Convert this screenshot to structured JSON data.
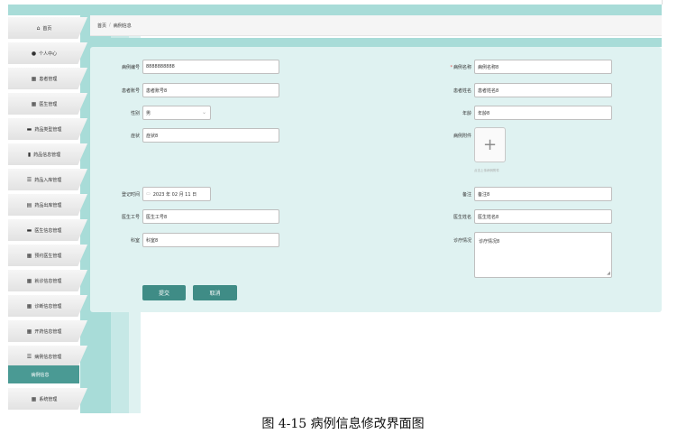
{
  "sidebar": {
    "items": [
      {
        "label": "首页",
        "icon": "home-icon",
        "glyph": "⌂"
      },
      {
        "label": "个人中心",
        "icon": "user-icon",
        "glyph": "●"
      },
      {
        "label": "患者管理",
        "icon": "grid-icon",
        "glyph": "▦"
      },
      {
        "label": "医生管理",
        "icon": "grid-icon",
        "glyph": "▦"
      },
      {
        "label": "药品类型管理",
        "icon": "briefcase-icon",
        "glyph": "▬"
      },
      {
        "label": "药品信息管理",
        "icon": "trash-icon",
        "glyph": "▮"
      },
      {
        "label": "药品入库管理",
        "icon": "list-icon",
        "glyph": "☰"
      },
      {
        "label": "药品出库管理",
        "icon": "document-icon",
        "glyph": "▤"
      },
      {
        "label": "医生信息管理",
        "icon": "message-icon",
        "glyph": "▬"
      },
      {
        "label": "预约医生管理",
        "icon": "grid-icon",
        "glyph": "▦"
      },
      {
        "label": "就诊信息管理",
        "icon": "grid-icon",
        "glyph": "▦"
      },
      {
        "label": "诊断信息管理",
        "icon": "grid-icon",
        "glyph": "▦"
      },
      {
        "label": "开药信息管理",
        "icon": "grid-icon",
        "glyph": "▦"
      },
      {
        "label": "病例信息管理",
        "icon": "menu-icon",
        "glyph": "☰"
      },
      {
        "label": "病例信息",
        "icon": "",
        "glyph": ""
      },
      {
        "label": "系统管理",
        "icon": "grid-icon",
        "glyph": "▦"
      }
    ],
    "active_index": 14
  },
  "breadcrumb": {
    "home": "首页",
    "separator": "/",
    "current": "病例信息"
  },
  "form": {
    "case_no": {
      "label": "病例编号",
      "value": "8888888888"
    },
    "case_name": {
      "label": "病例名称",
      "required_mark": "*",
      "value": "病例名称8"
    },
    "patient_account": {
      "label": "患者账号",
      "value": "患者账号8"
    },
    "patient_name": {
      "label": "患者姓名",
      "value": "患者姓名8"
    },
    "gender": {
      "label": "性别",
      "value": "男"
    },
    "age": {
      "label": "年龄",
      "value": "年龄8"
    },
    "symptom": {
      "label": "症状",
      "value": "症状8"
    },
    "attachment": {
      "label": "病例附件",
      "plus": "+",
      "tip": "点击上传病例附件"
    },
    "register_time": {
      "label": "登记时间",
      "value": "2023 年 02 月 11 日"
    },
    "remark": {
      "label": "备注",
      "value": "备注8"
    },
    "doctor_no": {
      "label": "医生工号",
      "value": "医生工号8"
    },
    "doctor_name": {
      "label": "医生姓名",
      "value": "医生姓名8"
    },
    "department": {
      "label": "科室",
      "value": "科室8"
    },
    "treatment": {
      "label": "诊疗情况",
      "value": "诊疗情况8"
    },
    "submit_label": "提交",
    "cancel_label": "取消"
  },
  "caption": "图 4-15 病例信息修改界面图"
}
